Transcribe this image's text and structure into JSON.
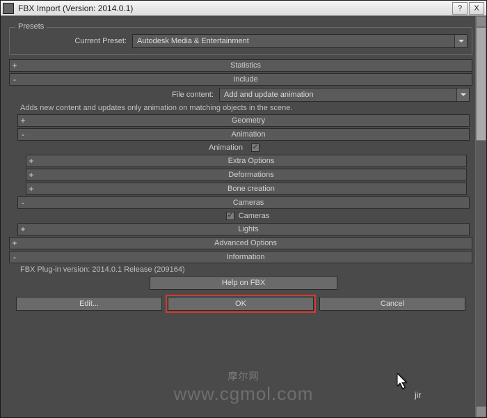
{
  "titlebar": {
    "title": "FBX Import (Version: 2014.0.1)",
    "help": "?",
    "close": "X"
  },
  "presets": {
    "group_label": "Presets",
    "current_preset_label": "Current Preset:",
    "current_preset_value": "Autodesk Media & Entertainment"
  },
  "sections": {
    "statistics_label": "Statistics",
    "include_label": "Include",
    "file_content_label": "File content:",
    "file_content_value": "Add and update animation",
    "file_content_hint": "Adds new content and updates only animation on matching objects in the scene.",
    "geometry_label": "Geometry",
    "animation_label": "Animation",
    "animation_chk_label": "Animation",
    "extra_options_label": "Extra Options",
    "deformations_label": "Deformations",
    "bone_creation_label": "Bone creation",
    "cameras_label": "Cameras",
    "cameras_chk_label": "Cameras",
    "lights_label": "Lights",
    "advanced_options_label": "Advanced Options",
    "information_label": "Information",
    "info_text": "FBX Plug-in version: 2014.0.1 Release (209164)",
    "help_on_fbx": "Help on FBX"
  },
  "footer": {
    "edit": "Edit...",
    "ok": "OK",
    "cancel": "Cancel"
  },
  "watermark": {
    "line1": "摩尔网",
    "line2": "www.cgmol.com"
  },
  "overlay": {
    "jir": "jir"
  }
}
